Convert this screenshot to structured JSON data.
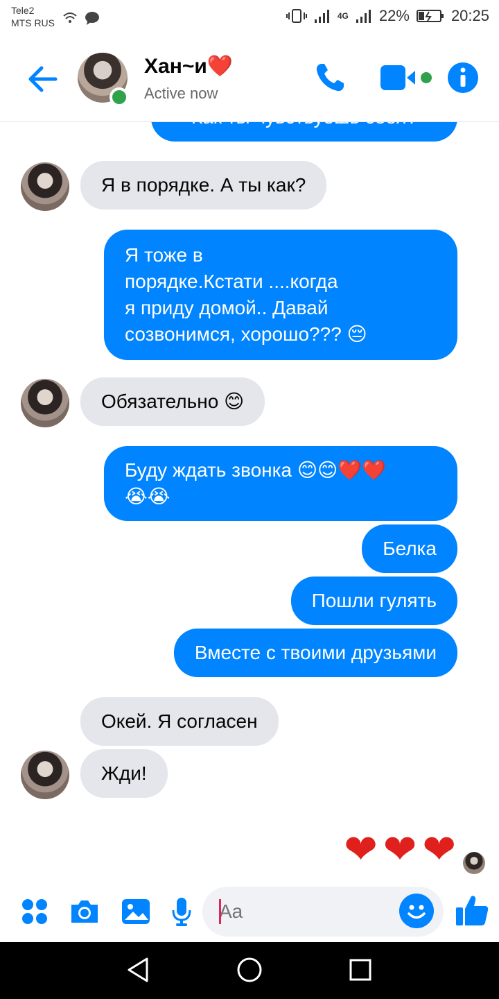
{
  "status_bar": {
    "carrier_line1": "Tele2",
    "carrier_line2": "MTS RUS",
    "network": "4G",
    "battery": "22%",
    "time": "20:25"
  },
  "header": {
    "name": "Хан~и❤️",
    "status": "Active now"
  },
  "messages": [
    {
      "side": "out",
      "text": "Как ты чувствуешь себя?"
    },
    {
      "side": "in",
      "text": "Я в порядке. А ты как?"
    },
    {
      "side": "out",
      "lines": [
        "Я тоже в",
        "порядке.Кстати ....когда",
        "я приду домой.. Давай",
        "созвонимся, хорошо??? 😔"
      ]
    },
    {
      "side": "in",
      "text": "Обязательно 😊"
    },
    {
      "side": "out",
      "lines": [
        "Буду ждать звонка 😊😊❤️❤️",
        "😭😭"
      ]
    },
    {
      "side": "out",
      "text": "Белка"
    },
    {
      "side": "out",
      "text": "Пошли гулять"
    },
    {
      "side": "out",
      "text": "Вместе с твоими друзьями"
    },
    {
      "side": "in",
      "text": "Окей. Я согласен"
    },
    {
      "side": "in",
      "text": "Жди!"
    },
    {
      "side": "out",
      "text": "❤❤❤"
    }
  ],
  "composer": {
    "placeholder": "Aa"
  },
  "colors": {
    "accent": "#0084ff",
    "online": "#31a24c",
    "incoming_bubble": "#e4e6eb",
    "heart": "#e0201c"
  },
  "icons": {
    "back": "back-arrow-icon",
    "call": "phone-icon",
    "video": "video-camera-icon",
    "info": "info-icon",
    "apps": "apps-grid-icon",
    "camera": "camera-icon",
    "gallery": "image-icon",
    "mic": "microphone-icon",
    "emoji": "smiley-icon",
    "like": "thumbs-up-icon",
    "nav_back": "triangle-back-icon",
    "nav_home": "circle-home-icon",
    "nav_recent": "square-recent-icon"
  }
}
